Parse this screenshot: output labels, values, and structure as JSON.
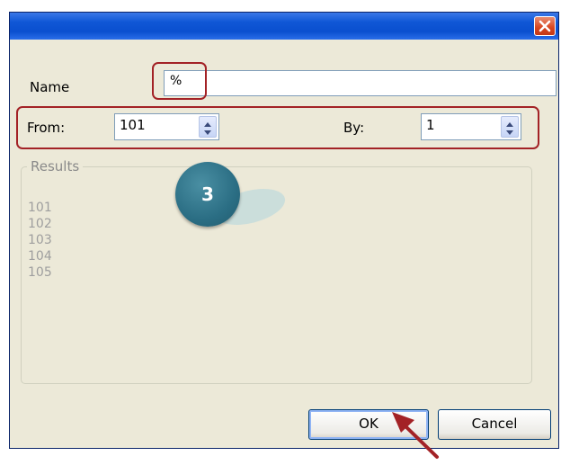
{
  "window": {
    "title": "",
    "close_icon": "close-x-icon"
  },
  "form": {
    "name_label": "Name",
    "name_value": "%",
    "from_label": "From:",
    "from_value": "101",
    "by_label": "By:",
    "by_value": "1"
  },
  "results": {
    "title": "Results",
    "items": [
      "101",
      "102",
      "103",
      "104",
      "105"
    ]
  },
  "annotation": {
    "step_number": "3"
  },
  "buttons": {
    "ok_label": "OK",
    "cancel_label": "Cancel"
  },
  "colors": {
    "highlight_red": "#a32226",
    "titlebar_blue": "#0a4fcf",
    "badge_teal": "#2b6e84",
    "dialog_bg": "#ece9d8"
  }
}
